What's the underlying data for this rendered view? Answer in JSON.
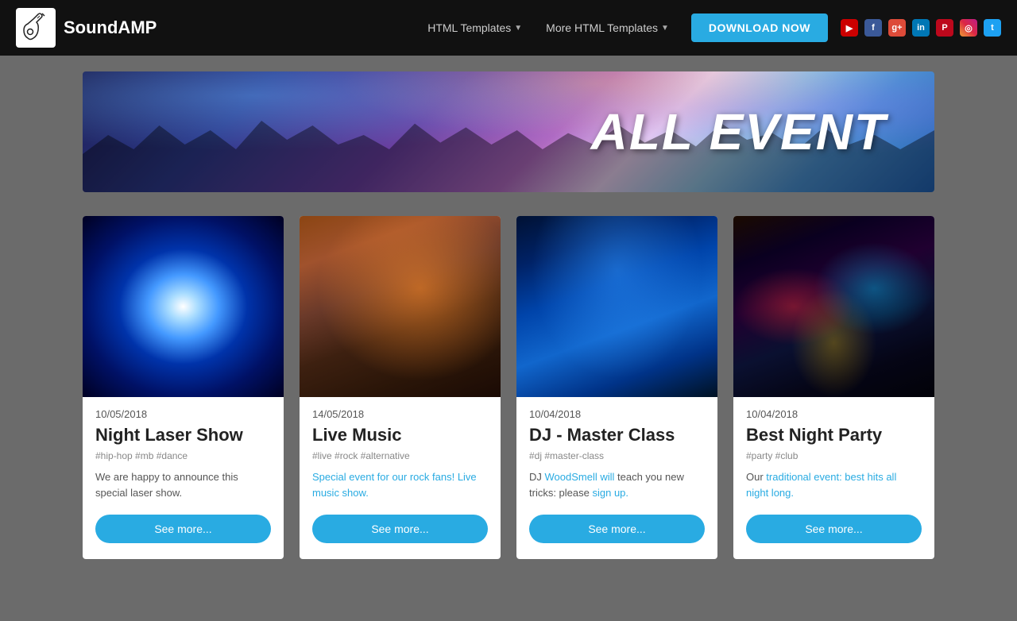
{
  "navbar": {
    "brand_name": "SoundAMP",
    "nav_link1": "HTML Templates",
    "nav_link2": "More HTML Templates",
    "download_btn": "DOWNLOAD NOW",
    "social_icons": [
      "YT",
      "f",
      "G+",
      "in",
      "P",
      "IG",
      "tw"
    ]
  },
  "hero": {
    "title": "ALL EVENT"
  },
  "events": [
    {
      "date": "10/05/2018",
      "title": "Night Laser Show",
      "tags": "#hip-hop #mb #dance",
      "description": "We are happy to announce this special laser show.",
      "btn_label": "See more...",
      "img_type": "laser"
    },
    {
      "date": "14/05/2018",
      "title": "Live Music",
      "tags": "#live #rock #alternative",
      "description": "Special event for our rock fans! Live music show.",
      "btn_label": "See more...",
      "img_type": "music"
    },
    {
      "date": "10/04/2018",
      "title": "DJ - Master Class",
      "tags": "#dj #master-class",
      "description": "DJ WoodSmell will teach you new tricks: please sign up.",
      "btn_label": "See more...",
      "img_type": "dj"
    },
    {
      "date": "10/04/2018",
      "title": "Best Night Party",
      "tags": "#party #club",
      "description": "Our traditional event: best hits all night long.",
      "btn_label": "See more...",
      "img_type": "party"
    }
  ],
  "social": {
    "youtube": "YT",
    "facebook": "f",
    "googleplus": "G+",
    "linkedin": "in",
    "pinterest": "P",
    "instagram": "IG",
    "twitter": "tw"
  }
}
